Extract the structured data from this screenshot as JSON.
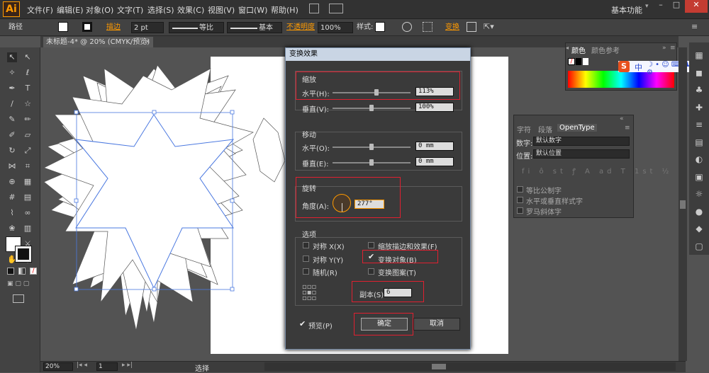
{
  "menubar": {
    "logo": "Ai",
    "items": [
      "文件(F)",
      "编辑(E)",
      "对象(O)",
      "文字(T)",
      "选择(S)",
      "效果(C)",
      "视图(V)",
      "窗口(W)",
      "帮助(H)"
    ],
    "workspace": "基本功能"
  },
  "control": {
    "path": "路径",
    "stroke_label": "描边",
    "stroke_value": "2 pt",
    "profile": "等比",
    "brush": "基本",
    "opacity_label": "不透明度",
    "opacity": "100%",
    "style_label": "样式:",
    "transform": "变换"
  },
  "doc_tab": "未标题-4* @ 20% (CMYK/预览)",
  "dialog": {
    "title": "变换效果",
    "scale": {
      "title": "缩放",
      "h_label": "水平(H):",
      "h_value": "113%",
      "v_label": "垂直(V):",
      "v_value": "100%"
    },
    "move": {
      "title": "移动",
      "h_label": "水平(O):",
      "h_value": "0 mm",
      "v_label": "垂直(E):",
      "v_value": "0 mm"
    },
    "rotate": {
      "title": "旋转",
      "angle_label": "角度(A):",
      "angle_value": "277°"
    },
    "options": {
      "title": "选项",
      "reflect_x": "对称 X(X)",
      "reflect_y": "对称 Y(Y)",
      "random": "随机(R)",
      "scale_strokes": "缩放描边和效果(F)",
      "transform_objects": "变换对象(B)",
      "transform_patterns": "变换图案(T)"
    },
    "copies_label": "副本(S)",
    "copies": "6",
    "preview": "预览(P)",
    "ok": "确定",
    "cancel": "取消"
  },
  "color_panel": {
    "tab1": "颜色",
    "tab2": "颜色参考"
  },
  "ot_panel": {
    "tabs": [
      "字符",
      "段落",
      "OpenType"
    ],
    "num_label": "数字:",
    "num_value": "默认数字",
    "pos_label": "位置:",
    "pos_value": "默认位置",
    "opts": [
      "等比公制字",
      "水平或垂直样式字",
      "罗马斜体字"
    ]
  },
  "status": {
    "zoom": "20%",
    "page": "1",
    "tool": "选择"
  },
  "ime": {
    "logo": "S",
    "mode": "中"
  },
  "colors": {
    "accent": "#ff9a00",
    "highlight": "#e02030",
    "selection": "#4a78e0"
  }
}
